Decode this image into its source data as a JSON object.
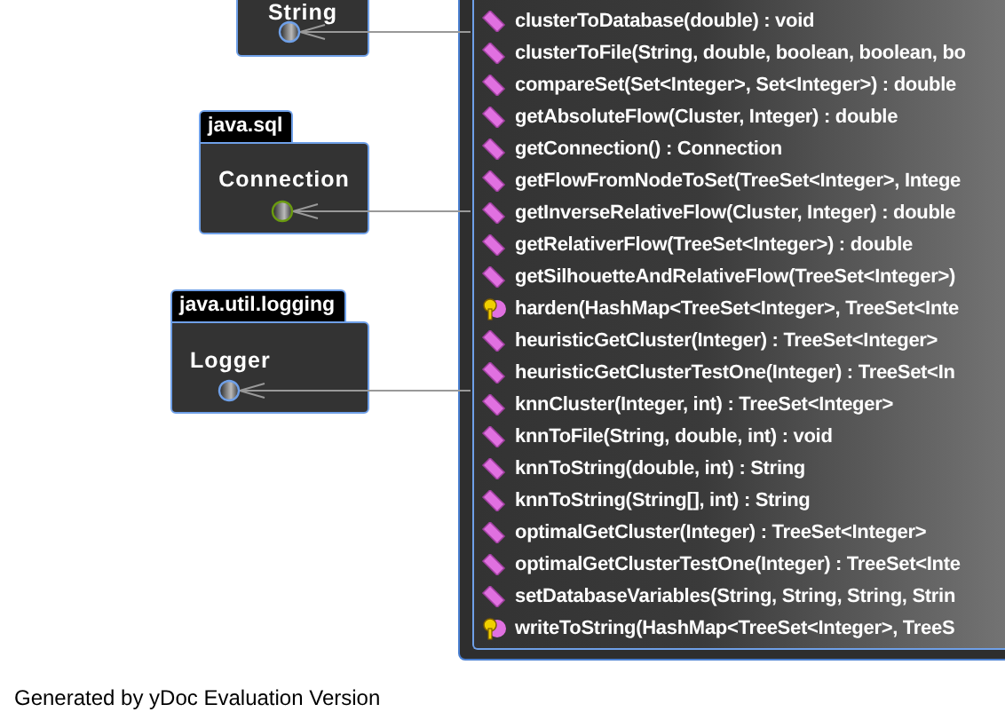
{
  "interfaces": [
    {
      "name": "String",
      "kind": "plain"
    },
    {
      "package": "java.sql",
      "name": "Connection",
      "kind": "highlighted"
    },
    {
      "package": "java.util.logging",
      "name": "Logger",
      "kind": "plain"
    }
  ],
  "methods": [
    {
      "kind": "public",
      "signature": "clusterToDatabase(double) : void"
    },
    {
      "kind": "public",
      "signature": "clusterToFile(String, double, boolean, boolean, bo"
    },
    {
      "kind": "public",
      "signature": "compareSet(Set<Integer>, Set<Integer>) : double"
    },
    {
      "kind": "public",
      "signature": "getAbsoluteFlow(Cluster, Integer) : double"
    },
    {
      "kind": "public",
      "signature": "getConnection() : Connection"
    },
    {
      "kind": "public",
      "signature": "getFlowFromNodeToSet(TreeSet<Integer>, Intege"
    },
    {
      "kind": "public",
      "signature": "getInverseRelativeFlow(Cluster, Integer) : double"
    },
    {
      "kind": "public",
      "signature": "getRelativerFlow(TreeSet<Integer>) : double"
    },
    {
      "kind": "public",
      "signature": "getSilhouetteAndRelativeFlow(TreeSet<Integer>)"
    },
    {
      "kind": "protected",
      "signature": "harden(HashMap<TreeSet<Integer>, TreeSet<Inte"
    },
    {
      "kind": "public",
      "signature": "heuristicGetCluster(Integer) : TreeSet<Integer>"
    },
    {
      "kind": "public",
      "signature": "heuristicGetClusterTestOne(Integer) : TreeSet<In"
    },
    {
      "kind": "public",
      "signature": "knnCluster(Integer, int) : TreeSet<Integer>"
    },
    {
      "kind": "public",
      "signature": "knnToFile(String, double, int) : void"
    },
    {
      "kind": "public",
      "signature": "knnToString(double, int) : String"
    },
    {
      "kind": "public",
      "signature": "knnToString(String[], int) : String"
    },
    {
      "kind": "public",
      "signature": "optimalGetCluster(Integer) : TreeSet<Integer>"
    },
    {
      "kind": "public",
      "signature": "optimalGetClusterTestOne(Integer) : TreeSet<Inte"
    },
    {
      "kind": "public",
      "signature": "setDatabaseVariables(String, String, String, Strin"
    },
    {
      "kind": "protected",
      "signature": "writeToString(HashMap<TreeSet<Integer>, TreeS"
    }
  ],
  "footer": "Generated by yDoc Evaluation Version"
}
